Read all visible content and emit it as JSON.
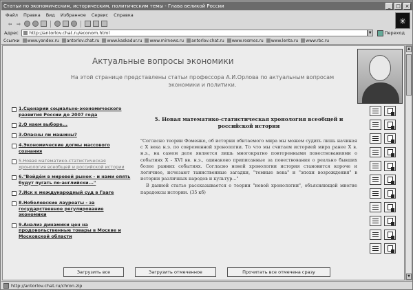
{
  "window": {
    "title": "Статьи по экономическим, историческим, политическим темы - Глава великой России",
    "buttons": [
      "_",
      "□",
      "×"
    ]
  },
  "menu": [
    "Файл",
    "Правка",
    "Вид",
    "Избранное",
    "Сервис",
    "Справка"
  ],
  "toolbar": {
    "back": "⇦",
    "forward": "⇨"
  },
  "address": {
    "label": "Адрес",
    "value": "http://antorlov.chat.ru/econom.html",
    "go_label": "Переход"
  },
  "links": [
    "Ссылки",
    "www.yandex.ru",
    "antorlov.chat.ru",
    "www.kaskadur.ru",
    "www.mirnews.ru",
    "antorlov.chat.ru",
    "www.rosmos.ru",
    "www.lenta.ru",
    "www.rbc.ru"
  ],
  "page": {
    "title": "Актуальные вопросы экономики",
    "subtitle": "На этой странице представлены статьи профессора А.И.Орлова по актуальным вопросам экономики и политики."
  },
  "articles": [
    {
      "title": "1.Сценарии социально-экономического развития России до 2007 года",
      "grey": false
    },
    {
      "title": "2.О наем выборе...",
      "grey": false
    },
    {
      "title": "3.Опасны ли машины?",
      "grey": false
    },
    {
      "title": "4.Экономические догмы массового сознания",
      "grey": false
    },
    {
      "title": "5.Новая математико-статистическая хронология всеобщей и российской истории",
      "grey": true
    },
    {
      "title": "6.\"Войдём в мировой рынок - и нами опять будут пугать по-английски...\"",
      "grey": false
    },
    {
      "title": "7.Иск к международный суд в Гааге",
      "grey": false
    },
    {
      "title": "8.Нобелевские лауреаты - за государственное регулирование экономики",
      "grey": false
    },
    {
      "title": "9.Анализ динамики цен на продовольственные товары в Москве и Московской области",
      "grey": false
    }
  ],
  "reading": {
    "heading": "5. Новая математико-статистическая хронология всеобщей и российской истории",
    "p1": "\"Согласно теории Фоменко, об истории обитаемого мира мы можем судить лишь начиная с Х века н.э. по современной хронологии. То что мы считаем историей мира ранее Х в. н.э., на самом деле является лишь многократно повторенными повествованиями о событиях Х - XVI вв. н.э., одинаково приписанные за повествования о реально бывших более ранних событиях. Согласно новой хронологии история становится короче и логичнее, исчезают таинственные загадки, \"темные века\" и \"эпохи возрождения\" в истории различных народов и культур...\"",
    "p2": "В данной статье рассказывается о теории \"новой хронологии\", объясняющей многие парадоксы истории. (35 кб)"
  },
  "bottom_buttons": {
    "load_all": "Загрузить все",
    "load_selected": "Загрузить отмеченное",
    "read_all": "Прочитать все отмечена сразу"
  },
  "status": {
    "url": "http://antorlov.chat.ru/chron.zip"
  },
  "colors": {
    "titlebar": "#6b6b6b",
    "content_bg": "#ececec"
  }
}
